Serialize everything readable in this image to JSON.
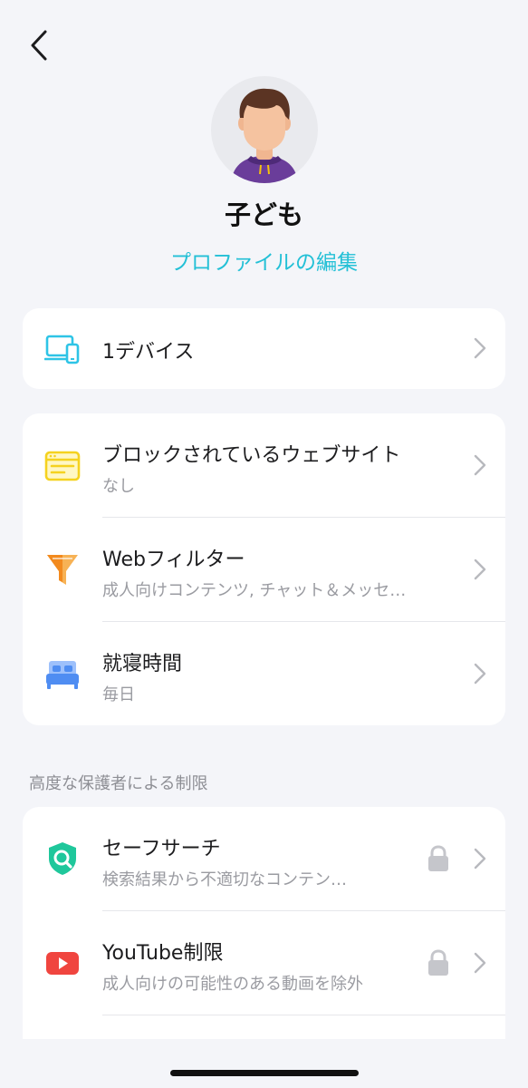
{
  "header": {
    "back_icon": "chevron-left-icon"
  },
  "profile": {
    "name": "子ども",
    "edit_label": "プロファイルの編集",
    "avatar_icon": "child-avatar-icon"
  },
  "devices": {
    "label": "1デバイス",
    "icon": "devices-icon",
    "accent": "#2ec4e6"
  },
  "controls": [
    {
      "title": "ブロックされているウェブサイト",
      "subtitle": "なし",
      "icon": "browser-window-icon",
      "color": "#f5d21f"
    },
    {
      "title": "Webフィルター",
      "subtitle": "成人向けコンテンツ, チャット＆メッセ…",
      "icon": "filter-funnel-icon",
      "color": "#f39a2b"
    },
    {
      "title": "就寝時間",
      "subtitle": "毎日",
      "icon": "bed-icon",
      "color": "#4f8df2"
    }
  ],
  "advanced": {
    "section_label": "高度な保護者による制限",
    "items": [
      {
        "title": "セーフサーチ",
        "subtitle": "検索結果から不適切なコンテンツを…",
        "icon": "safe-search-shield-icon",
        "color": "#1fc79b",
        "locked": true
      },
      {
        "title": "YouTube制限",
        "subtitle": "成人向けの可能性のある動画を除外",
        "icon": "youtube-play-icon",
        "color": "#f0453f",
        "locked": true
      }
    ]
  },
  "colors": {
    "accent": "#23c0d6",
    "background": "#f4f5f9"
  }
}
